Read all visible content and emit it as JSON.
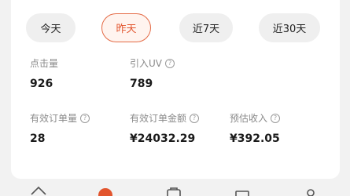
{
  "section_title": "",
  "date_filters": [
    {
      "label": "今天",
      "active": false
    },
    {
      "label": "昨天",
      "active": true
    },
    {
      "label": "近7天",
      "active": false
    },
    {
      "label": "近30天",
      "active": false
    }
  ],
  "metrics": {
    "clicks": {
      "label": "点击量",
      "value": "926"
    },
    "uv": {
      "label": "引入UV",
      "value": "789"
    },
    "orders": {
      "label": "有效订单量",
      "value": "28"
    },
    "order_amount": {
      "label": "有效订单金额",
      "value": "¥24032.29"
    },
    "income": {
      "label": "预估收入",
      "value": "¥392.05"
    }
  },
  "info_glyph": "?",
  "tab_icons": [
    "home-icon",
    "promo-icon",
    "bag-icon",
    "message-icon",
    "profile-icon"
  ],
  "colors": {
    "accent": "#e2552e",
    "accent_bg": "#fff4ef",
    "pill_bg": "#efefef"
  }
}
